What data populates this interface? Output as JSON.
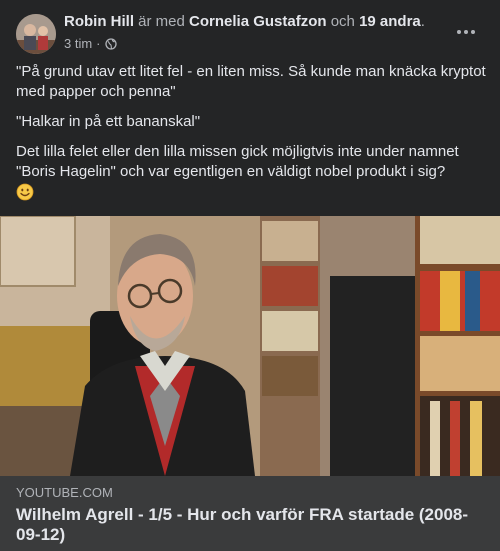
{
  "post": {
    "author": "Robin Hill",
    "with_text": "är med",
    "tagged": "Cornelia Gustafzon",
    "and_text": "och",
    "others": "19 andra",
    "period": ".",
    "time": "3 tim",
    "separator": "·",
    "audience_icon": "globe-icon",
    "more_icon": "more-options-icon",
    "paragraphs": [
      "\"På grund utav ett litet fel - en liten miss. Så kunde man knäcka kryptot med papper och penna\"",
      "\"Halkar in på ett bananskal\"",
      "Det lilla felet eller den lilla missen gick möjligtvis inte under namnet \"Boris Hagelin\" och var egentligen en väldigt nobel produkt i sig?"
    ],
    "emoji": "smiley-emoji"
  },
  "link_preview": {
    "domain": "YOUTUBE.COM",
    "title": "Wilhelm Agrell - 1/5 - Hur och varför FRA startade (2008-09-12)"
  },
  "colors": {
    "background": "#242526",
    "link_background": "#3a3b3c",
    "primary_text": "#e4e6eb",
    "secondary_text": "#b0b3b8"
  }
}
